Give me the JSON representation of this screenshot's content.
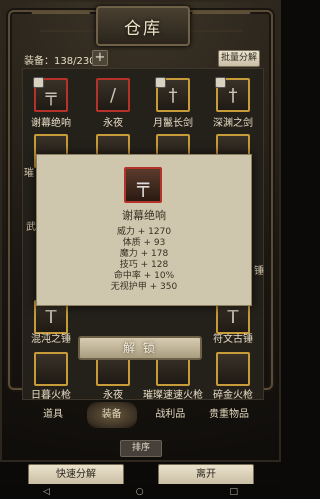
{
  "window": {
    "title": "仓库"
  },
  "header": {
    "count_label": "装备：138/230",
    "add_label": "+",
    "bulk_label": "批量分解"
  },
  "grid": {
    "row1": [
      {
        "name": "谢幕绝响",
        "icon": "revolver-icon"
      },
      {
        "name": "永夜",
        "icon": "dagger-icon"
      },
      {
        "name": "月鬣长剑",
        "icon": "sword-icon"
      },
      {
        "name": "深渊之剑",
        "icon": "sword-icon"
      }
    ],
    "row_bottom": [
      {
        "name": "混沌之锤",
        "icon": "hammer-icon"
      },
      {
        "name": "符文古锤",
        "icon": "hammer-icon"
      }
    ],
    "row_partial": [
      "日暮火枪",
      "永夜",
      "璀璨速速火枪",
      "碎金火枪"
    ],
    "side_left": [
      "璀",
      "武"
    ],
    "side_right": [
      "锤"
    ]
  },
  "tooltip": {
    "name": "谢幕绝响",
    "icon": "revolver-icon",
    "stats": [
      "威力 + 1270",
      "体质 + 93",
      "魔力 + 178",
      "技巧 + 128",
      "命中率 + 10%",
      "无视护甲 + 350"
    ]
  },
  "unlock_label": "解 锁",
  "tabs": [
    {
      "label": "道具",
      "active": false
    },
    {
      "label": "装备",
      "active": true
    },
    {
      "label": "战利品",
      "active": false
    },
    {
      "label": "贵重物品",
      "active": false
    }
  ],
  "sort_label": "排序",
  "bottom": {
    "quick_decompose": "快速分解",
    "leave": "离开"
  },
  "navbar": {
    "back": "◁",
    "home": "○",
    "recent": "□"
  },
  "colors": {
    "border_gold": "#c79a3a",
    "border_red": "#b5322a",
    "panel": "#cfc6ae"
  }
}
